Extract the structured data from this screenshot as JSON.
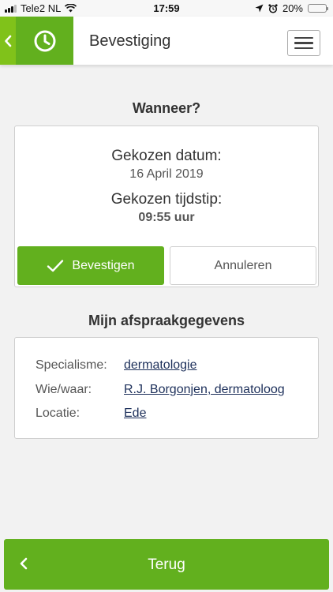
{
  "status_bar": {
    "carrier": "Tele2 NL",
    "time": "17:59",
    "battery": "20%",
    "battery_level": 0.2,
    "icons": [
      "signal-icon",
      "wifi-icon",
      "location-icon",
      "alarm-icon",
      "battery-icon"
    ]
  },
  "header": {
    "title": "Bevestiging",
    "icons": [
      "back-chevron-icon",
      "clock-icon",
      "hamburger-menu-icon"
    ]
  },
  "when": {
    "heading": "Wanneer?",
    "date_label": "Gekozen datum:",
    "date_value": "16 April 2019",
    "time_label": "Gekozen tijdstip:",
    "time_value": "09:55 uur",
    "confirm_label": "Bevestigen",
    "cancel_label": "Annuleren"
  },
  "details": {
    "heading": "Mijn afspraakgegevens",
    "rows": [
      {
        "key": "Specialisme:",
        "value": "dermatologie"
      },
      {
        "key": "Wie/waar:",
        "value": "R.J. Borgonjen, dermatoloog"
      },
      {
        "key": "Locatie:",
        "value": "Ede"
      }
    ]
  },
  "footer": {
    "back_label": "Terug"
  },
  "colors": {
    "primary_green": "#62b01e",
    "light_green": "#80c21a",
    "link_color": "#1c2f5a",
    "background": "#f2f2f2"
  }
}
